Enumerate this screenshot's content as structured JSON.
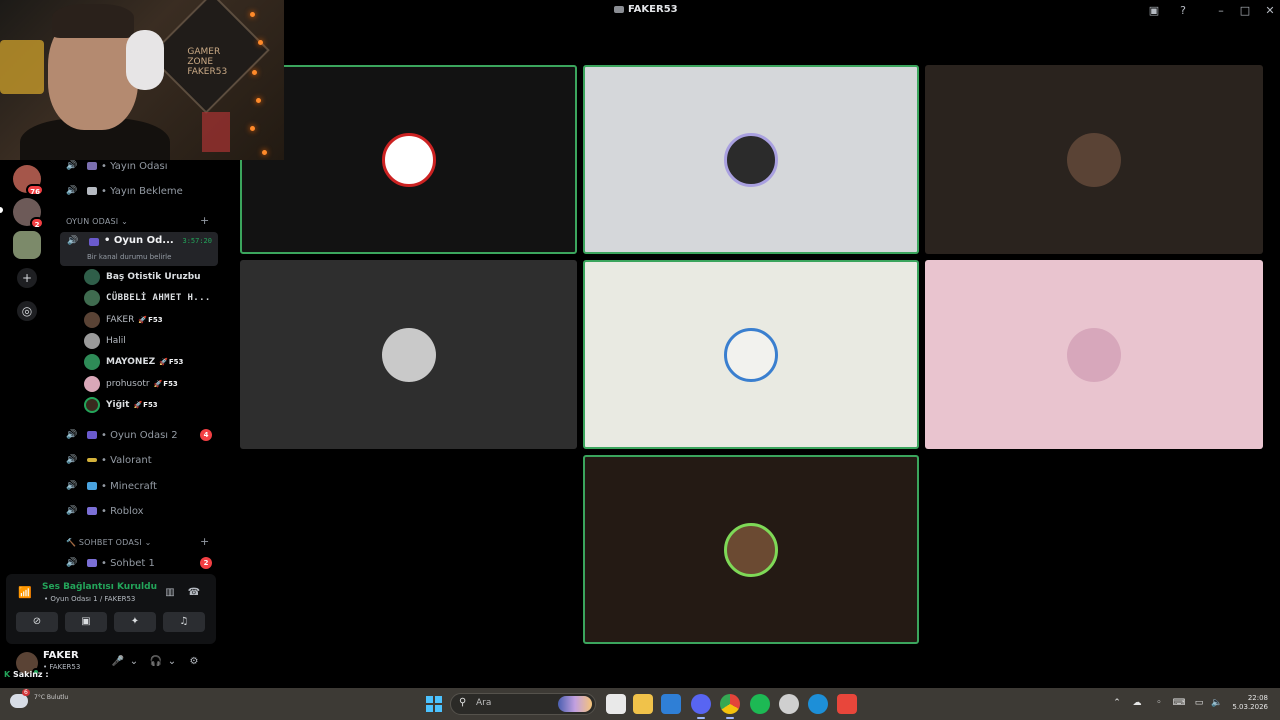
{
  "window": {
    "title": "FAKER53",
    "controls": [
      "inbox-icon",
      "help-icon",
      "minimize-icon",
      "maximize-icon",
      "close-icon"
    ]
  },
  "webcam": {
    "caption": "GAMER ZONE FAKER53"
  },
  "servers": [
    {
      "name": "server-1",
      "badge": "76",
      "color": "#a5564a"
    },
    {
      "name": "server-2",
      "badge": "2",
      "color": "#6d5a58"
    },
    {
      "name": "server-3",
      "badge": "",
      "color": "#7c8a6a"
    }
  ],
  "sidebar": {
    "top_channels": [
      {
        "label": "• Yayın Odası",
        "icon_color": "#7b6fb0"
      },
      {
        "label": "• Yayın Bekleme",
        "icon_color": "#b5bac1"
      }
    ],
    "category_game": "OYUN ODASI",
    "active_channel": {
      "label": "• Oyun Od...",
      "time": "3:57:20",
      "status": "Bir kanal durumu belirle"
    },
    "members": [
      {
        "name": "Baş Otistik Uruzbu",
        "tag": "",
        "avatar_color": "#2f5e49",
        "dim": false
      },
      {
        "name": "CÜBBELİ AHMET H...",
        "tag": "",
        "avatar_color": "#3f6b4f",
        "dim": false
      },
      {
        "name": "FAKER",
        "tag": "F53",
        "avatar_color": "#5a4335",
        "dim": true
      },
      {
        "name": "Halil",
        "tag": "",
        "avatar_color": "#9a9a9a",
        "dim": true
      },
      {
        "name": "MAYONEZ",
        "tag": "F53",
        "avatar_color": "#2e8b57",
        "dim": false
      },
      {
        "name": "prohusotr",
        "tag": "F53",
        "avatar_color": "#d9a7b8",
        "dim": true
      },
      {
        "name": "Yiğit",
        "tag": "F53",
        "avatar_color": "#3a2a1e",
        "dim": false
      }
    ],
    "game_channels": [
      {
        "label": "• Oyun Odası 2",
        "count": "4",
        "icon_color": "#6a5acd"
      },
      {
        "label": "• Valorant",
        "count": "",
        "icon_color": "#d4b13a"
      },
      {
        "label": "• Minecraft",
        "count": "",
        "icon_color": "#4aa3df"
      },
      {
        "label": "• Roblox",
        "count": "",
        "icon_color": "#7b6fd6"
      }
    ],
    "category_chat": "SOHBET ODASI",
    "chat_channels": [
      {
        "label": "• Sohbet 1",
        "count": "2",
        "icon_color": "#7b6fd6"
      }
    ]
  },
  "voice": {
    "title": "Ses Bağlantısı Kuruldu",
    "subtitle": "• Oyun Odası 1 / FAKER53"
  },
  "user": {
    "name": "FAKER",
    "sub": "• FAKER53",
    "status_text": "Sakinz :"
  },
  "tiles": [
    {
      "bg": "#121212",
      "speaking": true,
      "avatar": "#ffffff"
    },
    {
      "bg": "#d5d7da",
      "speaking": true,
      "avatar": "#2b2b2b"
    },
    {
      "bg": "#2a231e",
      "speaking": false,
      "avatar": "#5a4335"
    },
    {
      "bg": "#2e2e2e",
      "speaking": false,
      "avatar": "#c9c9c9"
    },
    {
      "bg": "#e9eae2",
      "speaking": true,
      "avatar": "#f2f2ee"
    },
    {
      "bg": "#e9c4cf",
      "speaking": false,
      "avatar": "#d7a7bb"
    },
    {
      "bg": "#241a14",
      "speaking": true,
      "avatar": "#6b4a32"
    }
  ],
  "taskbar": {
    "weather_badge": "6",
    "weather_text": "7°C Bulutlu",
    "search_placeholder": "Ara",
    "apps": [
      {
        "name": "file-explorer",
        "color": "#e9e9e9"
      },
      {
        "name": "folder",
        "color": "#f0c24a"
      },
      {
        "name": "store",
        "color": "#2f7fd6"
      },
      {
        "name": "discord",
        "color": "#5865f2"
      },
      {
        "name": "chrome",
        "color": "#e3443a"
      },
      {
        "name": "spotify",
        "color": "#1db954"
      },
      {
        "name": "steam",
        "color": "#cfcfcf"
      },
      {
        "name": "edge",
        "color": "#1d8fd8"
      },
      {
        "name": "adobe",
        "color": "#e8463b"
      }
    ],
    "time": "22:08",
    "date": "5.03.2026"
  }
}
